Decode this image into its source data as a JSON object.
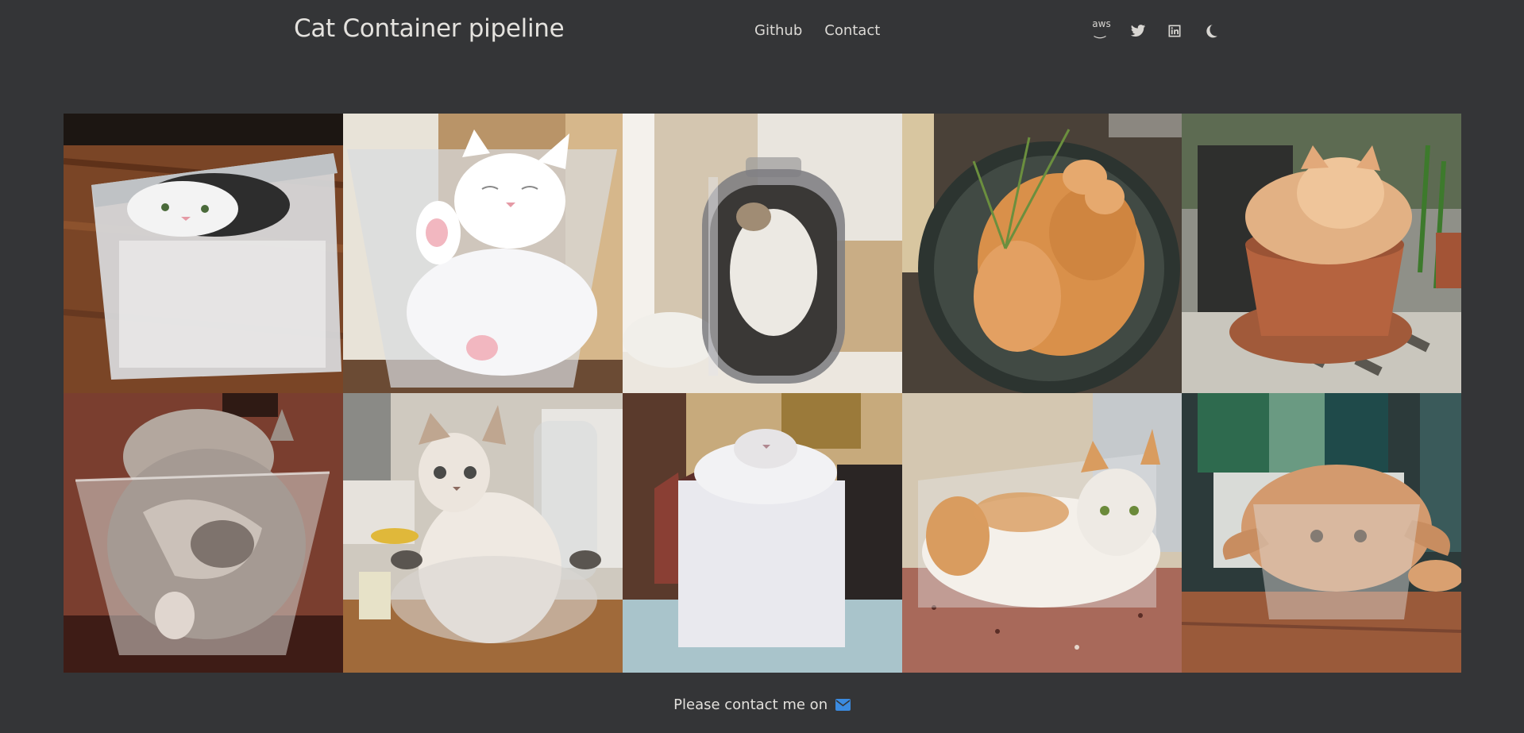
{
  "header": {
    "title": "Cat Container pipeline",
    "nav": [
      {
        "label": "Github"
      },
      {
        "label": "Contact"
      }
    ],
    "icons": [
      "aws-icon",
      "twitter-icon",
      "linkedin-icon",
      "moon-icon"
    ],
    "aws_label": "aws"
  },
  "gallery": {
    "images": [
      {
        "alt": "cat in plastic box"
      },
      {
        "alt": "white kitten in glass bowl"
      },
      {
        "alt": "cat in glass jar"
      },
      {
        "alt": "two orange cats in pot"
      },
      {
        "alt": "orange cat in flower pot"
      },
      {
        "alt": "grey cat in glass bowl"
      },
      {
        "alt": "kitten in glass bowl"
      },
      {
        "alt": "white cat in square container"
      },
      {
        "alt": "cat in clear box"
      },
      {
        "alt": "persian cat in plastic container"
      }
    ]
  },
  "footer": {
    "text": "Please contact me on"
  },
  "colors": {
    "background": "#343537",
    "mail_icon": "#3b8be0"
  }
}
